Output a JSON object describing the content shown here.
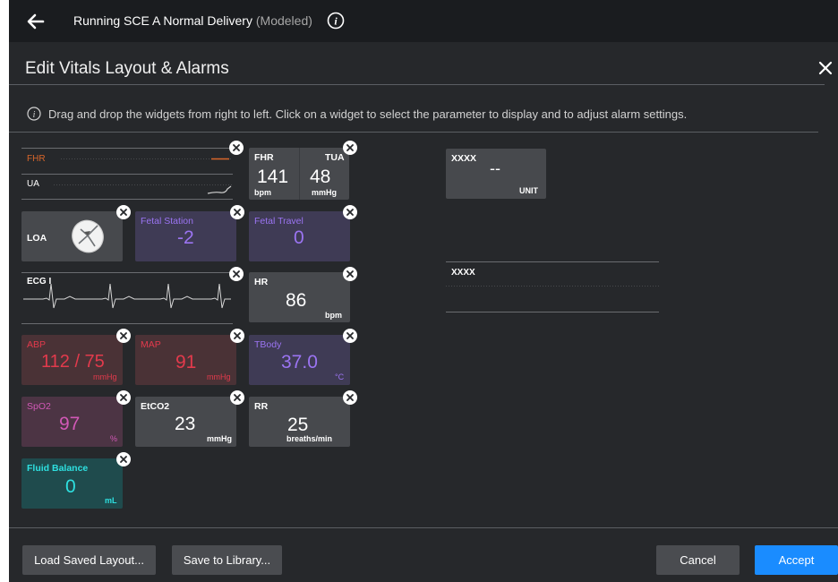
{
  "header": {
    "title_main": "Running SCE  A Normal Delivery",
    "title_modeled": "(Modeled)"
  },
  "dialog": {
    "title": "Edit Vitals Layout & Alarms",
    "instructions": "Drag and drop the widgets from right to left. Click on a widget to select the parameter to display and to adjust alarm settings."
  },
  "widgets": {
    "waveform_fhr_ua": {
      "fhr_label": "FHR",
      "ua_label": "UA"
    },
    "fhr_tua": {
      "fhr_label": "FHR",
      "fhr_value": "141",
      "fhr_unit": "bpm",
      "tua_label": "TUA",
      "tua_value": "48",
      "tua_unit": "mmHg"
    },
    "loa": {
      "label": "LOA"
    },
    "fetal_station": {
      "label": "Fetal Station",
      "value": "-2"
    },
    "fetal_travel": {
      "label": "Fetal Travel",
      "value": "0"
    },
    "ecg": {
      "label": "ECG I"
    },
    "hr": {
      "label": "HR",
      "value": "86",
      "unit": "bpm"
    },
    "abp": {
      "label": "ABP",
      "value": "112 / 75",
      "unit": "mmHg"
    },
    "map": {
      "label": "MAP",
      "value": "91",
      "unit": "mmHg"
    },
    "tbody": {
      "label": "TBody",
      "value": "37.0",
      "unit": "°C"
    },
    "spo2": {
      "label": "SpO2",
      "value": "97",
      "unit": "%"
    },
    "etco2": {
      "label": "EtCO2",
      "value": "23",
      "unit": "mmHg"
    },
    "rr": {
      "label": "RR",
      "value": "25",
      "unit": "breaths/min"
    },
    "fluid_balance": {
      "label": "Fluid Balance",
      "value": "0",
      "unit": "mL"
    }
  },
  "palette": {
    "numeric_template": {
      "label": "XXXX",
      "value": "--",
      "unit": "UNIT"
    },
    "waveform_template": {
      "label": "XXXX"
    }
  },
  "footer": {
    "load_label": "Load Saved Layout...",
    "save_label": "Save to Library...",
    "cancel_label": "Cancel",
    "accept_label": "Accept"
  },
  "colors": {
    "background": "#26282b",
    "topbar": "#1a1c1f",
    "widget": "#47494d",
    "accent_blue": "#1a8cff",
    "fhr_orange": "#d9662b",
    "fetal_purple": "#9b74f2",
    "bp_red": "#e23a4c",
    "spo2_pink": "#d158b6",
    "fluid_teal": "#2ee0e0"
  },
  "icons": [
    "back-arrow-icon",
    "info-icon",
    "close-icon",
    "remove-widget-icon",
    "fetal-head-icon"
  ]
}
